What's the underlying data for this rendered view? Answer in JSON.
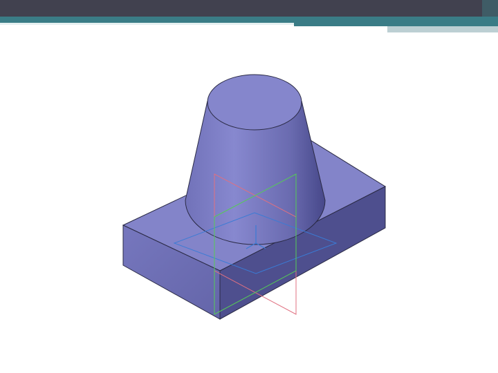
{
  "slide": {
    "header_color": "#41414f",
    "accent_color": "#3a7c86",
    "accent_light_color": "#bccfd3"
  },
  "model": {
    "description_icon": "cad-3d-part-icon",
    "face_colors": {
      "top": "#8a8bcf",
      "front": "#6f70b8",
      "side": "#4e4f8e",
      "cone": "#7b7cc4",
      "cone_top": "#8586cc"
    },
    "plane_colors": {
      "xy": "#3a7bd5",
      "zy": "#e07080",
      "zx": "#55cc55"
    }
  }
}
